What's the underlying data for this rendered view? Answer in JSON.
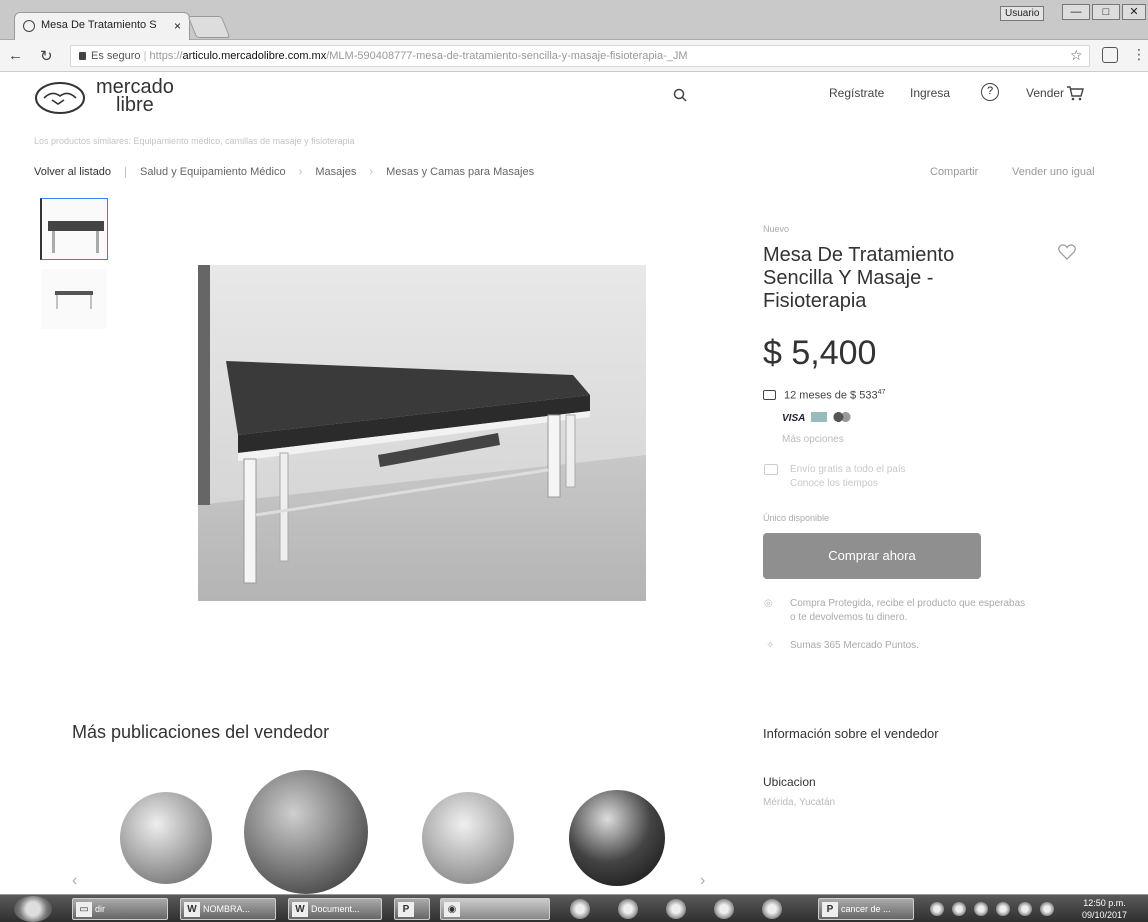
{
  "browser": {
    "tab_title": "Mesa De Tratamiento S",
    "tab_close": "×",
    "user_tag": "Usuario",
    "secure_label": "Es seguro",
    "url_scheme": "https://",
    "url_domain": "articulo.mercadolibre.com.mx",
    "url_path": "/MLM-590408777-mesa-de-tratamiento-sencilla-y-masaje-fisioterapia-_JM",
    "minimize": "—",
    "maximize": "□",
    "close": "✕"
  },
  "header": {
    "logo_line1": "mercado",
    "logo_line2": "libre",
    "register": "Regístrate",
    "login": "Ingresa",
    "sell": "Vender"
  },
  "faded_line": "Los productos similares: Equipamiento médico, camillas de masaje y fisioterapia",
  "breadcrumb": {
    "back": "Volver al listado",
    "items": [
      "Salud y Equipamiento Médico",
      "Masajes",
      "Mesas y Camas para Masajes"
    ],
    "share": "Compartir",
    "sell_one": "Vender uno igual"
  },
  "product": {
    "condition": "Nuevo",
    "title": "Mesa De Tratamiento Sencilla Y Masaje - Fisioterapia",
    "price": "$ 5,400",
    "installments": "12 meses de $ 533",
    "installments_cents": "47",
    "visa": "VISA",
    "more_options": "Más opciones",
    "shipping_line1": "Envío gratis a todo el país",
    "shipping_line2": "Conoce los tiempos",
    "stock": "Único disponible",
    "buy_button": "Comprar ahora",
    "guarantee_line1": "Compra Protegida, recibe el producto que esperabas",
    "guarantee_line2": "o te devolvemos tu dinero.",
    "points": "Sumas 365 Mercado Puntos."
  },
  "sections": {
    "more_from_seller": "Más publicaciones del vendedor",
    "seller_info": "Información sobre el vendedor",
    "location_label": "Ubicacion",
    "location_value": "Mérida, Yucatán"
  },
  "taskbar": {
    "items": [
      "dir",
      "NOMBRA...",
      "Document...",
      "",
      "",
      "cancer de ..."
    ],
    "clock_time": "12:50 p.m.",
    "clock_date": "09/10/2017"
  }
}
